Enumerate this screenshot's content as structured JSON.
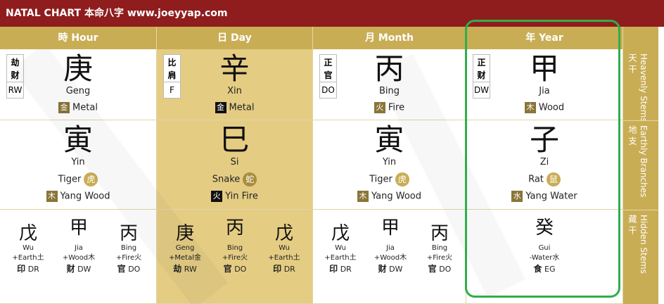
{
  "title": "NATAL CHART 本命八字 www.joeyyap.com",
  "headers": [
    "時 Hour",
    "日 Day",
    "月 Month",
    "年 Year"
  ],
  "side_labels": [
    {
      "cn": "天 干",
      "en": "Heavenly Stems"
    },
    {
      "cn": "地 支",
      "en": "Earthly Branches"
    },
    {
      "cn": "藏 干",
      "en": "Hidden Stems"
    }
  ],
  "stems": [
    {
      "god1": "劫",
      "god2": "财",
      "god_abbr": "RW",
      "char": "庚",
      "pinyin": "Geng",
      "elem_char": "金",
      "elem": "Metal"
    },
    {
      "god1": "比",
      "god2": "肩",
      "god_abbr": "F",
      "char": "辛",
      "pinyin": "Xin",
      "elem_char": "金",
      "elem": "Metal"
    },
    {
      "god1": "正",
      "god2": "官",
      "god_abbr": "DO",
      "char": "丙",
      "pinyin": "Bing",
      "elem_char": "火",
      "elem": "Fire"
    },
    {
      "god1": "正",
      "god2": "财",
      "god_abbr": "DW",
      "char": "甲",
      "pinyin": "Jia",
      "elem_char": "木",
      "elem": "Wood"
    }
  ],
  "branches": [
    {
      "char": "寅",
      "pinyin": "Yin",
      "animal": "Tiger",
      "animal_char": "虎",
      "elem_char": "木",
      "elem": "Yang Wood"
    },
    {
      "char": "巳",
      "pinyin": "Si",
      "animal": "Snake",
      "animal_char": "蛇",
      "elem_char": "火",
      "elem": "Yin Fire"
    },
    {
      "char": "寅",
      "pinyin": "Yin",
      "animal": "Tiger",
      "animal_char": "虎",
      "elem_char": "木",
      "elem": "Yang Wood"
    },
    {
      "char": "子",
      "pinyin": "Zi",
      "animal": "Rat",
      "animal_char": "鼠",
      "elem_char": "水",
      "elem": "Yang Water"
    }
  ],
  "hidden": [
    [
      {
        "char": "戊",
        "pinyin": "Wu",
        "elem": "+Earth土",
        "god_char": "印",
        "god": "DR"
      },
      {
        "char": "甲",
        "pinyin": "Jia",
        "elem": "+Wood木",
        "god_char": "财",
        "god": "DW"
      },
      {
        "char": "丙",
        "pinyin": "Bing",
        "elem": "+Fire火",
        "god_char": "官",
        "god": "DO"
      }
    ],
    [
      {
        "char": "庚",
        "pinyin": "Geng",
        "elem": "+Metal金",
        "god_char": "劫",
        "god": "RW"
      },
      {
        "char": "丙",
        "pinyin": "Bing",
        "elem": "+Fire火",
        "god_char": "官",
        "god": "DO"
      },
      {
        "char": "戊",
        "pinyin": "Wu",
        "elem": "+Earth土",
        "god_char": "印",
        "god": "DR"
      }
    ],
    [
      {
        "char": "戊",
        "pinyin": "Wu",
        "elem": "+Earth土",
        "god_char": "印",
        "god": "DR"
      },
      {
        "char": "甲",
        "pinyin": "Jia",
        "elem": "+Wood木",
        "god_char": "财",
        "god": "DW"
      },
      {
        "char": "丙",
        "pinyin": "Bing",
        "elem": "+Fire火",
        "god_char": "官",
        "god": "DO"
      }
    ],
    [
      {
        "char": "癸",
        "pinyin": "Gui",
        "elem": "-Water水",
        "god_char": "食",
        "god": "EG"
      }
    ]
  ],
  "colors": {
    "title_bg": "#8f1d1d",
    "header_bg": "#c9ad55",
    "day_bg": "#e4cc83",
    "highlight": "#2fae4a"
  }
}
